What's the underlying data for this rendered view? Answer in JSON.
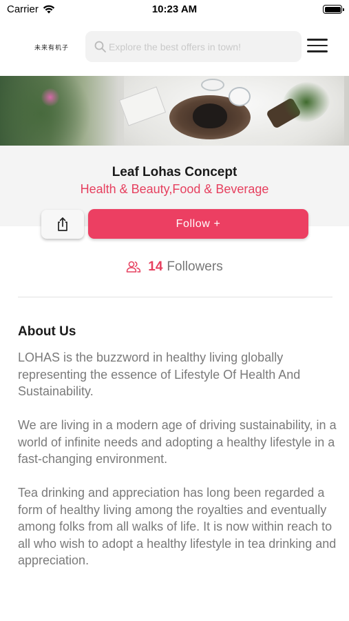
{
  "status_bar": {
    "carrier": "Carrier",
    "time": "10:23 AM",
    "battery_level": 1.0
  },
  "header": {
    "logo_text": "未来有机子",
    "search_placeholder": "Explore the best offers in town!",
    "icons": {
      "search": "search-icon",
      "menu": "hamburger-menu-icon"
    }
  },
  "banner": {
    "image_description_icon": "banner-image"
  },
  "store": {
    "name": "Leaf Lohas Concept",
    "category": "Health & Beauty,Food & Beverage",
    "follow_label": "Follow +",
    "followers_count": "14",
    "followers_label": "Followers",
    "accent_color": "#ec3f62"
  },
  "about": {
    "title": "About Us",
    "paragraphs": [
      "LOHAS is the buzzword in healthy living globally representing the essence of Lifestyle Of Health And Sustainability.",
      "We are living in a modern age of driving sustainability, in a world of infinite needs and adopting a healthy lifestyle in a fast-changing environment.",
      "Tea drinking and appreciation has long been regarded a form of healthy living among the royalties and eventually among folks from all walks of life. It is now within reach to all who wish to adopt a healthy lifestyle in tea drinking and appreciation."
    ]
  }
}
